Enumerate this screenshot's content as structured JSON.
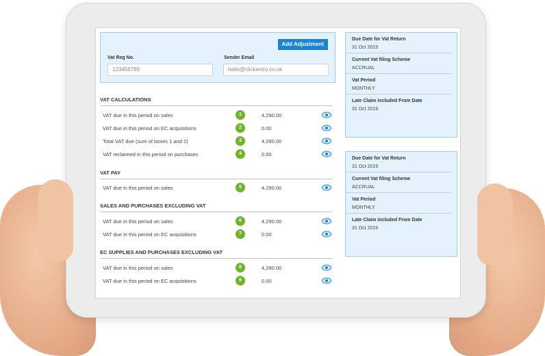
{
  "form": {
    "add_button": "Add Adjustment",
    "vat_reg_label": "Vat Reg No.",
    "vat_reg_value": "123456789",
    "sender_email_label": "Sender Email",
    "sender_email_value": "hello@clickentry.co.uk"
  },
  "sections": [
    {
      "title": "VAT CALCULATIONS",
      "rows": [
        {
          "label": "VAT due in this period on sales",
          "box": "1",
          "value": "4,290.00"
        },
        {
          "label": "VAT due in this period on EC acquisitions",
          "box": "2",
          "value": "0.00"
        },
        {
          "label": "Total VAT due (sum of boxes 1 and 2)",
          "box": "3",
          "value": "4,290.00"
        },
        {
          "label": "VAT reclaimed in this period on purchases",
          "box": "4",
          "value": "0.00"
        }
      ]
    },
    {
      "title": "VAT PAY",
      "rows": [
        {
          "label": "VAT due in this period on sales",
          "box": "5",
          "value": "4,290.00"
        }
      ]
    },
    {
      "title": "SALES AND PURCHASES EXCLUDING VAT",
      "rows": [
        {
          "label": "VAT due in this period on sales",
          "box": "6",
          "value": "4,290.00"
        },
        {
          "label": "VAT due in this period on EC acquisitions",
          "box": "7",
          "value": "0.00"
        }
      ]
    },
    {
      "title": "EC SUPPLIES AND PURCHASES EXCLUDING VAT",
      "rows": [
        {
          "label": "VAT due in this period on sales",
          "box": "8",
          "value": "4,290.00"
        },
        {
          "label": "VAT due in this period on EC acquisitions",
          "box": "9",
          "value": "0.00"
        }
      ]
    }
  ],
  "side_panels": [
    {
      "items": [
        {
          "key": "Due Date for Vat Return",
          "value": "31 Oct 2019"
        },
        {
          "key": "Current Vat filing Scheme",
          "value": "ACCRUAL"
        },
        {
          "key": "Vat Period",
          "value": "MONTHLY"
        },
        {
          "key": "Late Claim included From Date",
          "value": "31 Oct 2019"
        }
      ]
    },
    {
      "items": [
        {
          "key": "Due Date for Vat Return",
          "value": "31 Oct 2019"
        },
        {
          "key": "Current Vat filing Scheme",
          "value": "ACCRUAL"
        },
        {
          "key": "Vat Period",
          "value": "MONTHLY"
        },
        {
          "key": "Late Claim included From Date",
          "value": "31 Oct 2019"
        }
      ]
    }
  ],
  "icons": {
    "view": "eye-icon"
  },
  "colors": {
    "accent": "#1a83d6",
    "badge": "#6fb52c",
    "panel_bg": "#e3f2fc",
    "panel_border": "#9ccbea"
  }
}
